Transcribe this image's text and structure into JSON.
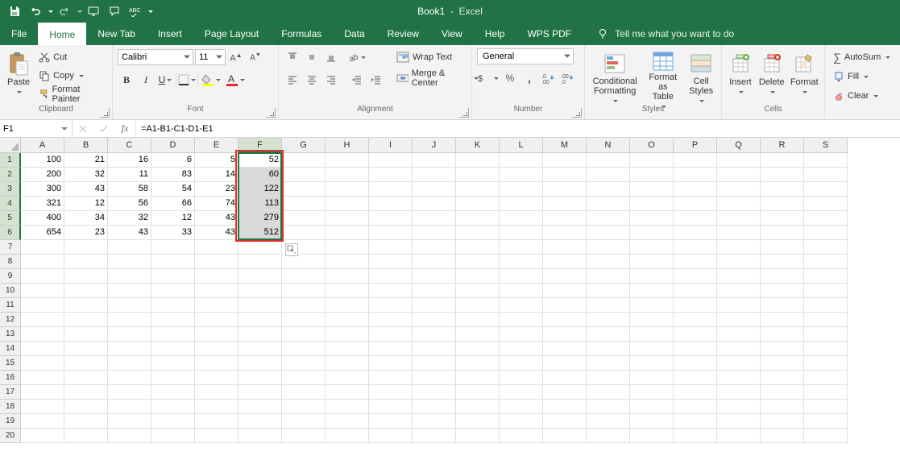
{
  "title": {
    "doc": "Book1",
    "app": "Excel"
  },
  "tabs": {
    "file": "File",
    "home": "Home",
    "newtab": "New Tab",
    "insert": "Insert",
    "pagelayout": "Page Layout",
    "formulas": "Formulas",
    "data": "Data",
    "review": "Review",
    "view": "View",
    "help": "Help",
    "wpspdf": "WPS PDF",
    "tellme": "Tell me what you want to do"
  },
  "ribbon": {
    "clipboard": {
      "paste": "Paste",
      "cut": "Cut",
      "copy": "Copy",
      "format_painter": "Format Painter",
      "label": "Clipboard"
    },
    "font": {
      "name": "Calibri",
      "size": "11",
      "label": "Font"
    },
    "alignment": {
      "wrap": "Wrap Text",
      "merge": "Merge & Center",
      "label": "Alignment"
    },
    "number": {
      "format": "General",
      "label": "Number"
    },
    "styles": {
      "cond": "Conditional\nFormatting",
      "fmtas": "Format as\nTable",
      "cell": "Cell\nStyles",
      "label": "Styles"
    },
    "cells": {
      "insert": "Insert",
      "delete": "Delete",
      "format": "Format",
      "label": "Cells"
    },
    "editing": {
      "autosum": "AutoSum",
      "fill": "Fill",
      "clear": "Clear"
    }
  },
  "formula_bar": {
    "namebox": "F1",
    "formula": "=A1-B1-C1-D1-E1"
  },
  "grid": {
    "columns": [
      "A",
      "B",
      "C",
      "D",
      "E",
      "F",
      "G",
      "H",
      "I",
      "J",
      "K",
      "L",
      "M",
      "N",
      "O",
      "P",
      "Q",
      "R",
      "S"
    ],
    "visible_rows": 20,
    "data": [
      [
        100,
        21,
        16,
        6,
        5,
        52
      ],
      [
        200,
        32,
        11,
        83,
        14,
        60
      ],
      [
        300,
        43,
        58,
        54,
        23,
        122
      ],
      [
        321,
        12,
        56,
        66,
        74,
        113
      ],
      [
        400,
        34,
        32,
        12,
        43,
        279
      ],
      [
        654,
        23,
        43,
        33,
        43,
        512
      ]
    ],
    "selection": {
      "col": 5,
      "row_start": 0,
      "row_end": 5
    },
    "highlight": {
      "col": 5,
      "row_start": 0,
      "row_end": 5
    }
  }
}
